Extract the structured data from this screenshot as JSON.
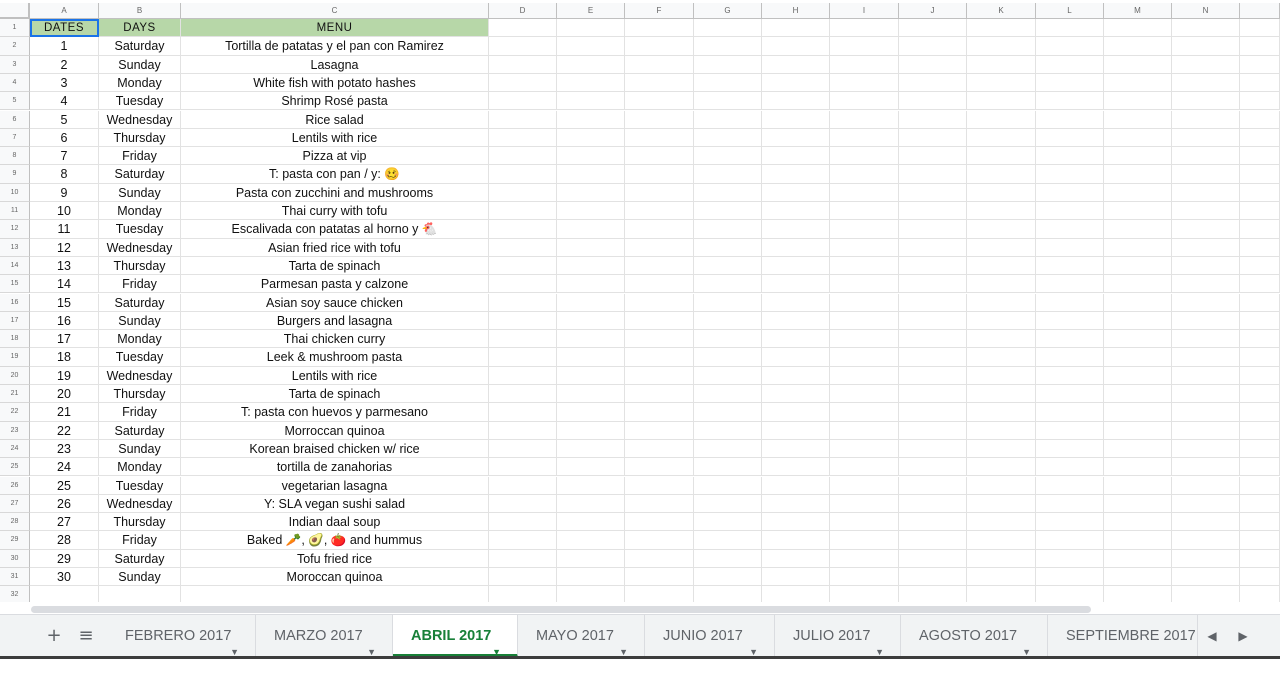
{
  "columns": [
    "A",
    "B",
    "C",
    "D",
    "E",
    "F",
    "G",
    "H",
    "I",
    "J",
    "K",
    "L",
    "M",
    "N"
  ],
  "headers": {
    "dates": "DATES",
    "days": "DAYS",
    "menu": "MENU"
  },
  "row_numbers": [
    "1",
    "2",
    "3",
    "4",
    "5",
    "6",
    "7",
    "8",
    "9",
    "10",
    "11",
    "12",
    "13",
    "14",
    "15",
    "16",
    "17",
    "18",
    "19",
    "20",
    "21",
    "22",
    "23",
    "24",
    "25",
    "26",
    "27",
    "28",
    "29",
    "30",
    "31",
    "32"
  ],
  "rows": [
    {
      "date": "1",
      "day": "Saturday",
      "menu": "Tortilla de patatas y el pan con Ramirez"
    },
    {
      "date": "2",
      "day": "Sunday",
      "menu": "Lasagna"
    },
    {
      "date": "3",
      "day": "Monday",
      "menu": "White fish with potato hashes"
    },
    {
      "date": "4",
      "day": "Tuesday",
      "menu": "Shrimp Rosé pasta"
    },
    {
      "date": "5",
      "day": "Wednesday",
      "menu": "Rice salad"
    },
    {
      "date": "6",
      "day": "Thursday",
      "menu": "Lentils with rice"
    },
    {
      "date": "7",
      "day": "Friday",
      "menu": "Pizza at vip"
    },
    {
      "date": "8",
      "day": "Saturday",
      "menu": "T: pasta con pan / y: 🥴"
    },
    {
      "date": "9",
      "day": "Sunday",
      "menu": "Pasta con zucchini and mushrooms"
    },
    {
      "date": "10",
      "day": "Monday",
      "menu": "Thai curry with tofu"
    },
    {
      "date": "11",
      "day": "Tuesday",
      "menu": "Escalivada con patatas al horno y 🐔"
    },
    {
      "date": "12",
      "day": "Wednesday",
      "menu": "Asian fried rice with tofu"
    },
    {
      "date": "13",
      "day": "Thursday",
      "menu": "Tarta de spinach"
    },
    {
      "date": "14",
      "day": "Friday",
      "menu": "Parmesan pasta y calzone"
    },
    {
      "date": "15",
      "day": "Saturday",
      "menu": "Asian soy sauce chicken"
    },
    {
      "date": "16",
      "day": "Sunday",
      "menu": "Burgers and lasagna"
    },
    {
      "date": "17",
      "day": "Monday",
      "menu": "Thai chicken curry"
    },
    {
      "date": "18",
      "day": "Tuesday",
      "menu": "Leek & mushroom pasta"
    },
    {
      "date": "19",
      "day": "Wednesday",
      "menu": "Lentils with rice"
    },
    {
      "date": "20",
      "day": "Thursday",
      "menu": "Tarta de spinach"
    },
    {
      "date": "21",
      "day": "Friday",
      "menu": "T: pasta con huevos y parmesano"
    },
    {
      "date": "22",
      "day": "Saturday",
      "menu": "Morroccan quinoa"
    },
    {
      "date": "23",
      "day": "Sunday",
      "menu": "Korean braised chicken w/ rice"
    },
    {
      "date": "24",
      "day": "Monday",
      "menu": "tortilla de zanahorias"
    },
    {
      "date": "25",
      "day": "Tuesday",
      "menu": "vegetarian lasagna"
    },
    {
      "date": "26",
      "day": "Wednesday",
      "menu": "Y: SLA vegan sushi salad"
    },
    {
      "date": "27",
      "day": "Thursday",
      "menu": "Indian daal soup"
    },
    {
      "date": "28",
      "day": "Friday",
      "menu": "Baked 🥕, 🥑, 🍅 and hummus"
    },
    {
      "date": "29",
      "day": "Saturday",
      "menu": "Tofu fried rice"
    },
    {
      "date": "30",
      "day": "Sunday",
      "menu": "Moroccan quinoa"
    }
  ],
  "tabbar": {
    "add_icon": "plus-icon",
    "add_glyph": "+",
    "list_icon": "all-sheets-icon",
    "list_glyph": "≡",
    "tabs": [
      {
        "label": "FEBRERO 2017"
      },
      {
        "label": "MARZO 2017"
      },
      {
        "label": "ABRIL 2017",
        "active": true
      },
      {
        "label": "MAYO 2017"
      },
      {
        "label": "JUNIO 2017"
      },
      {
        "label": "JULIO 2017"
      },
      {
        "label": "AGOSTO 2017"
      },
      {
        "label": "SEPTIEMBRE 2017"
      }
    ],
    "caret_glyph": "▼",
    "prev_glyph": "◀",
    "next_glyph": "▶"
  },
  "colors": {
    "header_fill": "#b7d7a8",
    "active_tab": "#188038",
    "selection": "#1a73e8"
  }
}
